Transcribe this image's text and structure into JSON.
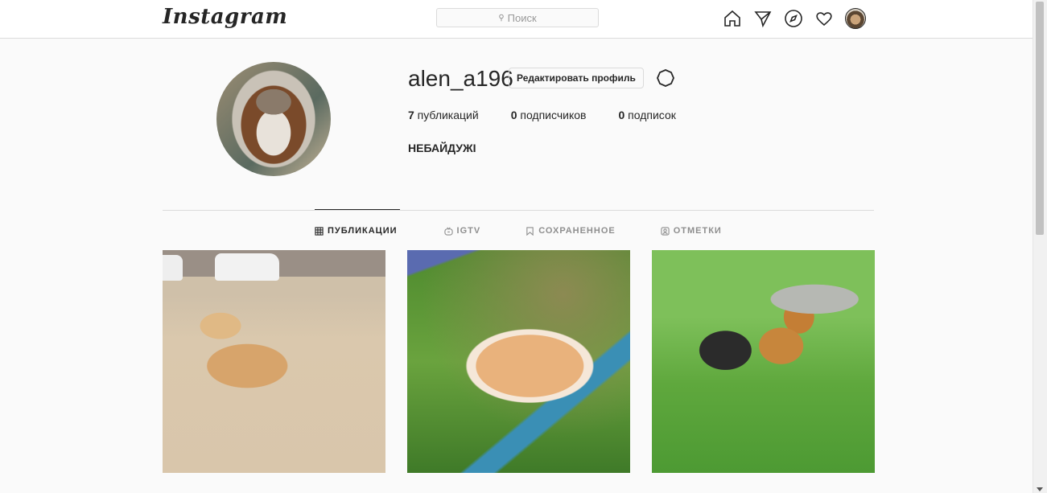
{
  "header": {
    "logo": "Instagram",
    "search_placeholder": "Поиск",
    "icons": [
      "home-icon",
      "direct-icon",
      "explore-icon",
      "activity-heart-icon",
      "profile-avatar"
    ]
  },
  "profile": {
    "username": "alen_a196",
    "edit_button": "Редактировать профиль",
    "stats": [
      {
        "count": "7",
        "label": " публикаций"
      },
      {
        "count": "0",
        "label": " подписчиков"
      },
      {
        "count": "0",
        "label": " подписок"
      }
    ],
    "full_name": "НЕБАЙДУЖІ"
  },
  "tabs": [
    {
      "label": "ПУБЛИКАЦИИ",
      "icon": "grid-icon",
      "active": true
    },
    {
      "label": "IGTV",
      "icon": "igtv-icon",
      "active": false
    },
    {
      "label": "СОХРАНЕННОЕ",
      "icon": "bookmark-icon",
      "active": false
    },
    {
      "label": "ОТМЕТКИ",
      "icon": "tagged-icon",
      "active": false
    }
  ],
  "colors": {
    "background": "#fafafa",
    "text": "#262626",
    "muted": "#8e8e8e",
    "border": "#dbdbdb"
  }
}
